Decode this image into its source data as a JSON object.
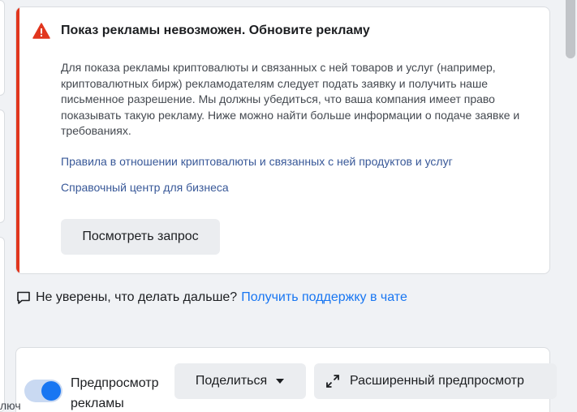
{
  "alert": {
    "title": "Показ рекламы невозможен. Обновите рекламу",
    "body": "Для показа рекламы криптовалюты и связанных с ней товаров и услуг (например, криптовалютных бирж) рекламодателям следует подать заявку и получить наше письменное разрешение. Мы должны убедиться, что ваша компания имеет право показывать такую рекламу. Ниже можно найти больше информации о подаче заявке и требованиях.",
    "link_policy": "Правила в отношении криптовалюты и связанных с ней продуктов и услуг",
    "link_help_center": "Справочный центр для бизнеса",
    "review_button": "Посмотреть запрос",
    "icon": "warning-triangle-icon",
    "accent_color": "#e1361e"
  },
  "support": {
    "question": "Не уверены, что делать дальше?",
    "link": "Получить поддержку в чате",
    "icon": "chat-bubble-icon"
  },
  "preview_bar": {
    "toggle_label": "Предпросмотр рекламы",
    "toggle_on": true,
    "share_button": "Поделиться",
    "advanced_preview_button": "Расширенный предпросмотр"
  },
  "cut_off_text": "люч",
  "colors": {
    "link": "#385898",
    "primary": "#1876f2",
    "button_bg": "#ebedf0"
  }
}
